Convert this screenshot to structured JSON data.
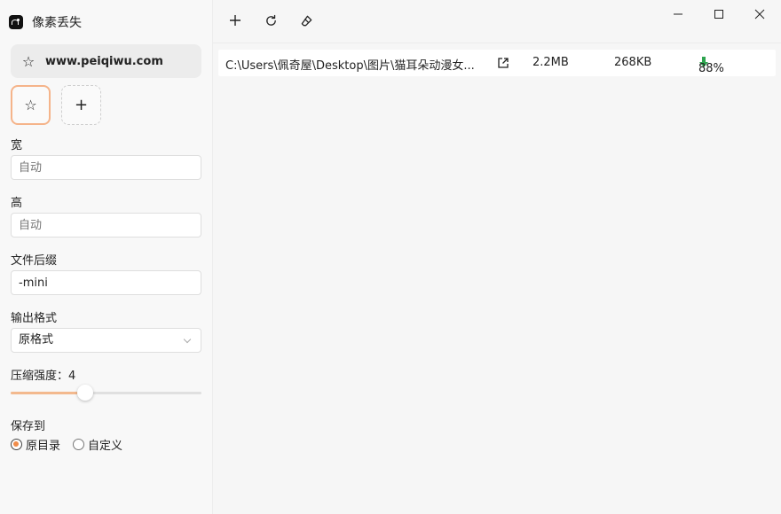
{
  "app": {
    "title": "像素丢失",
    "logo_icon": "app-logo-icon"
  },
  "toolbar": {
    "add_icon": "plus-icon",
    "refresh_icon": "refresh-icon",
    "clear_icon": "eraser-icon"
  },
  "window_controls": {
    "minimize": "minimize-icon",
    "maximize": "maximize-icon",
    "close": "close-icon"
  },
  "preset": {
    "label": "www.peiqiwu.com",
    "icon": "star-icon"
  },
  "preset_buttons": [
    {
      "icon": "star-icon",
      "active": true
    },
    {
      "icon": "plus-icon",
      "active": false
    }
  ],
  "settings": {
    "width": {
      "label": "宽",
      "value": "",
      "placeholder": "自动"
    },
    "height": {
      "label": "高",
      "value": "",
      "placeholder": "自动"
    },
    "suffix": {
      "label": "文件后缀",
      "value": "-mini"
    },
    "format": {
      "label": "输出格式",
      "selected": "原格式"
    },
    "compression": {
      "label": "压缩强度：",
      "value": "4",
      "level_fraction": 0.39
    },
    "save_to": {
      "label": "保存到",
      "options": [
        {
          "label": "原目录",
          "checked": true
        },
        {
          "label": "自定义",
          "checked": false
        }
      ]
    }
  },
  "files": [
    {
      "path": "C:\\Users\\佩奇屋\\Desktop\\图片\\猫耳朵动漫女...",
      "original_size": "2.2MB",
      "compressed_size": "268KB",
      "ratio": "88%"
    }
  ],
  "colors": {
    "accent": "#f08c4a",
    "accent_light": "#f3b98e",
    "success_green": "#2ea44f"
  }
}
